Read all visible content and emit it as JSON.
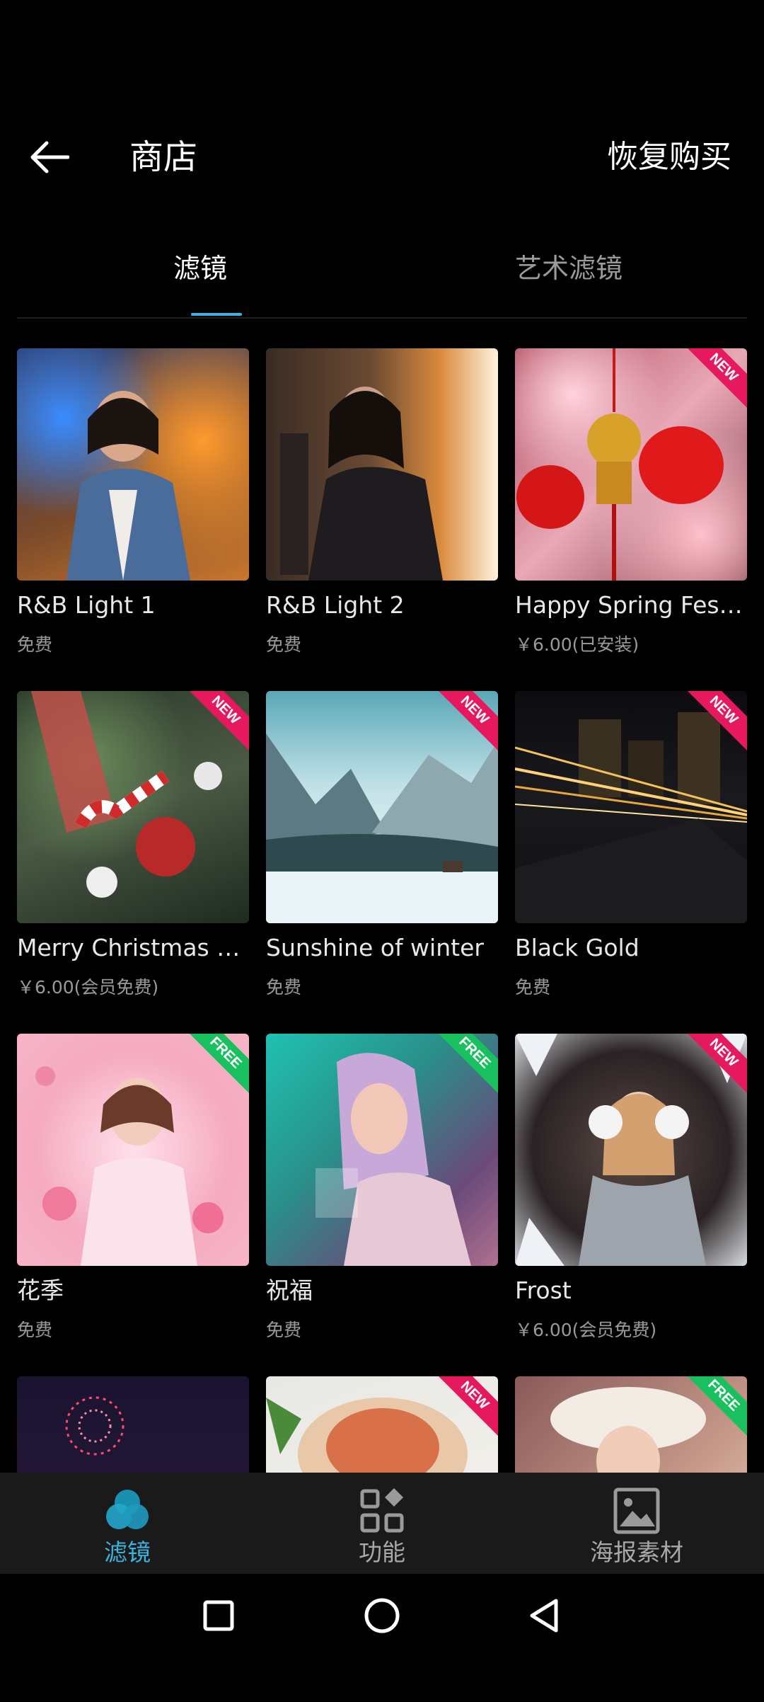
{
  "header": {
    "title": "商店",
    "restore_label": "恢复购买"
  },
  "tabs": [
    {
      "label": "滤镜",
      "active": true
    },
    {
      "label": "艺术滤镜",
      "active": false
    }
  ],
  "items": [
    {
      "name": "R&B Light 1",
      "price": "免费",
      "badge": ""
    },
    {
      "name": "R&B Light 2",
      "price": "免费",
      "badge": ""
    },
    {
      "name": "Happy Spring Festi…",
      "price": "￥6.00(已安装)",
      "badge": "NEW"
    },
    {
      "name": "Merry Christmas an…",
      "price": "￥6.00(会员免费)",
      "badge": "NEW"
    },
    {
      "name": "Sunshine of winter",
      "price": "免费",
      "badge": "NEW"
    },
    {
      "name": "Black Gold",
      "price": "免费",
      "badge": "NEW"
    },
    {
      "name": "花季",
      "price": "免费",
      "badge": "FREE"
    },
    {
      "name": "祝福",
      "price": "免费",
      "badge": "FREE"
    },
    {
      "name": "Frost",
      "price": "￥6.00(会员免费)",
      "badge": "NEW"
    },
    {
      "name": "",
      "price": "",
      "badge": ""
    },
    {
      "name": "",
      "price": "",
      "badge": "NEW"
    },
    {
      "name": "",
      "price": "",
      "badge": "FREE"
    }
  ],
  "bottom_nav": [
    {
      "label": "滤镜",
      "icon": "filter-icon",
      "active": true
    },
    {
      "label": "功能",
      "icon": "grid-icon",
      "active": false
    },
    {
      "label": "海报素材",
      "icon": "image-icon",
      "active": false
    }
  ],
  "colors": {
    "accent": "#3bb4e0",
    "badge_new": "#e6195e",
    "badge_free": "#19c15e"
  }
}
